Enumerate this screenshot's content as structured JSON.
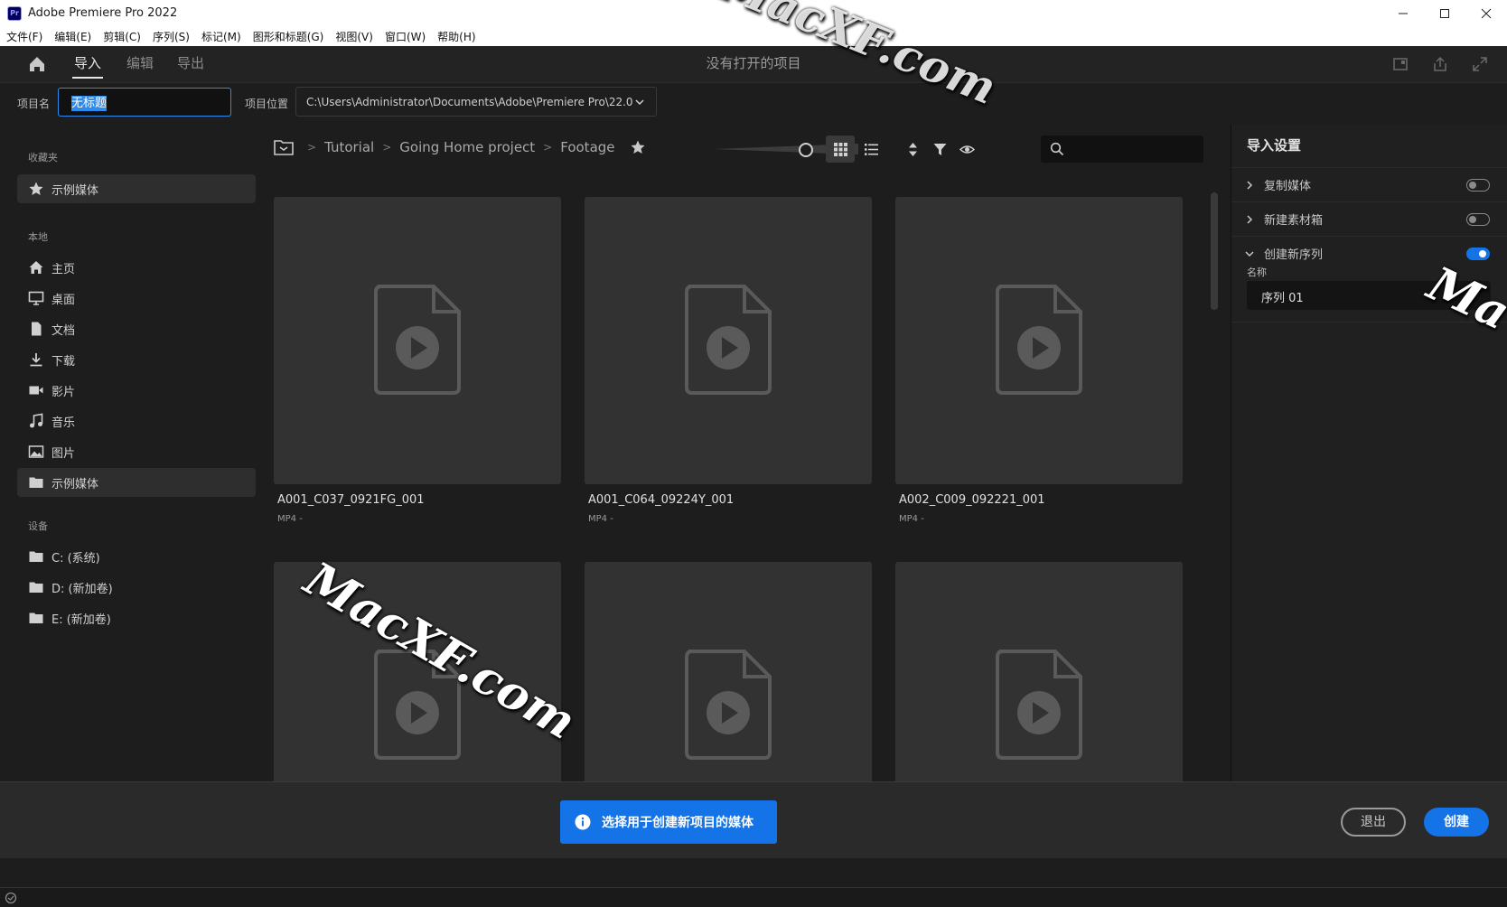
{
  "window": {
    "title": "Adobe Premiere Pro 2022",
    "app_badge": "Pr"
  },
  "menu": [
    "文件(F)",
    "编辑(E)",
    "剪辑(C)",
    "序列(S)",
    "标记(M)",
    "图形和标题(G)",
    "视图(V)",
    "窗口(W)",
    "帮助(H)"
  ],
  "nav": {
    "tabs": [
      "导入",
      "编辑",
      "导出"
    ],
    "active_tab": "导入",
    "center_title": "没有打开的项目"
  },
  "project": {
    "name_label": "项目名",
    "name_value": "无标题",
    "location_label": "项目位置",
    "location_value": "C:\\Users\\Administrator\\Documents\\Adobe\\Premiere Pro\\22.0"
  },
  "sidebar": {
    "favorites_title": "收藏夹",
    "favorites": [
      {
        "label": "示例媒体",
        "icon": "star-icon"
      }
    ],
    "local_title": "本地",
    "local": [
      {
        "label": "主页",
        "icon": "home-icon"
      },
      {
        "label": "桌面",
        "icon": "desktop-icon"
      },
      {
        "label": "文档",
        "icon": "document-icon"
      },
      {
        "label": "下载",
        "icon": "download-icon"
      },
      {
        "label": "影片",
        "icon": "video-icon"
      },
      {
        "label": "音乐",
        "icon": "music-icon"
      },
      {
        "label": "图片",
        "icon": "image-icon"
      },
      {
        "label": "示例媒体",
        "icon": "folder-icon"
      }
    ],
    "devices_title": "设备",
    "devices": [
      {
        "label": "C: (系统)",
        "icon": "folder-icon"
      },
      {
        "label": "D: (新加卷)",
        "icon": "folder-icon"
      },
      {
        "label": "E: (新加卷)",
        "icon": "folder-icon"
      }
    ]
  },
  "breadcrumb": [
    "Tutorial",
    "Going Home project",
    "Footage"
  ],
  "search": {
    "placeholder": ""
  },
  "clips": [
    {
      "name": "A001_C037_0921FG_001",
      "meta": "MP4 -"
    },
    {
      "name": "A001_C064_09224Y_001",
      "meta": "MP4 -"
    },
    {
      "name": "A002_C009_092221_001",
      "meta": "MP4 -"
    },
    {
      "name": "",
      "meta": ""
    },
    {
      "name": "",
      "meta": ""
    },
    {
      "name": "",
      "meta": ""
    }
  ],
  "import_settings": {
    "title": "导入设置",
    "rows": [
      {
        "label": "复制媒体",
        "enabled": false
      },
      {
        "label": "新建素材箱",
        "enabled": false
      },
      {
        "label": "创建新序列",
        "enabled": true
      }
    ],
    "name_label": "名称",
    "name_value": "序列 01"
  },
  "footer": {
    "toast": "选择用于创建新项目的媒体",
    "exit_label": "退出",
    "create_label": "创建"
  },
  "colors": {
    "accent": "#1473e6",
    "panel": "#1d1d1d",
    "card": "#323232"
  },
  "watermarks": [
    "MacXF.com",
    "MacXF.com",
    "Ma"
  ]
}
